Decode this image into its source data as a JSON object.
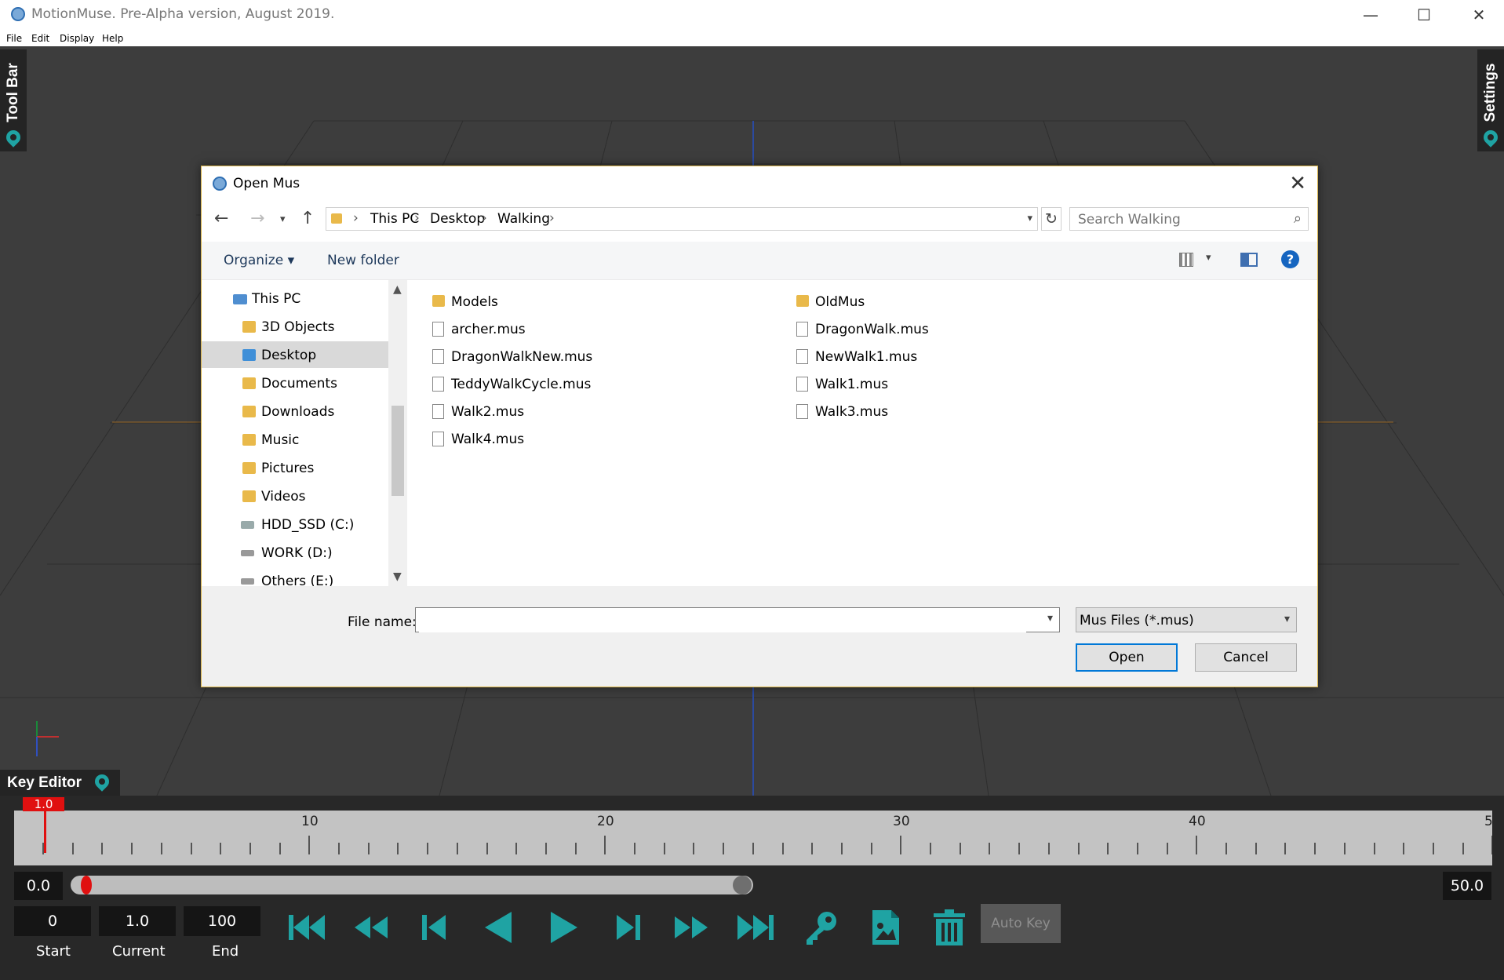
{
  "window": {
    "title": "MotionMuse. Pre-Alpha version, August 2019.",
    "controls": {
      "minimize": "—",
      "maximize": "☐",
      "close": "✕"
    }
  },
  "menu": [
    "File",
    "Edit",
    "Display",
    "Help"
  ],
  "panels": {
    "toolbar_tab": "Tool Bar",
    "settings_tab": "Settings",
    "key_editor_tab": "Key Editor"
  },
  "dialog": {
    "title": "Open Mus",
    "breadcrumb": [
      "This PC",
      "Desktop",
      "Walking"
    ],
    "search_placeholder": "Search Walking",
    "commands": {
      "organize": "Organize ▾",
      "new_folder": "New folder"
    },
    "nav_items": [
      {
        "label": "This PC",
        "selected": false
      },
      {
        "label": "3D Objects",
        "selected": false
      },
      {
        "label": "Desktop",
        "selected": true
      },
      {
        "label": "Documents",
        "selected": false
      },
      {
        "label": "Downloads",
        "selected": false
      },
      {
        "label": "Music",
        "selected": false
      },
      {
        "label": "Pictures",
        "selected": false
      },
      {
        "label": "Videos",
        "selected": false
      },
      {
        "label": "HDD_SSD (C:)",
        "selected": false
      },
      {
        "label": "WORK (D:)",
        "selected": false
      },
      {
        "label": "Others (E:)",
        "selected": false
      }
    ],
    "files_col1": [
      {
        "name": "Models",
        "type": "folder"
      },
      {
        "name": "archer.mus",
        "type": "file"
      },
      {
        "name": "DragonWalkNew.mus",
        "type": "file"
      },
      {
        "name": "TeddyWalkCycle.mus",
        "type": "file"
      },
      {
        "name": "Walk2.mus",
        "type": "file"
      },
      {
        "name": "Walk4.mus",
        "type": "file"
      }
    ],
    "files_col2": [
      {
        "name": "OldMus",
        "type": "folder"
      },
      {
        "name": "DragonWalk.mus",
        "type": "file"
      },
      {
        "name": "NewWalk1.mus",
        "type": "file"
      },
      {
        "name": "Walk1.mus",
        "type": "file"
      },
      {
        "name": "Walk3.mus",
        "type": "file"
      }
    ],
    "file_name_label": "File name:",
    "file_name_value": "",
    "filter_value": "Mus Files (*.mus)",
    "open_label": "Open",
    "cancel_label": "Cancel"
  },
  "timeline": {
    "playhead_label": "1.0",
    "ruler_numbers": [
      "10",
      "20",
      "30",
      "40",
      "5"
    ],
    "range_start_display": "0.0",
    "range_end_display": "50.0",
    "start_value": "0",
    "current_value": "1.0",
    "end_value": "100",
    "start_label": "Start",
    "current_label": "Current",
    "end_label": "End",
    "autokey_label": "Auto Key",
    "accent_color": "#1fa3a3"
  }
}
